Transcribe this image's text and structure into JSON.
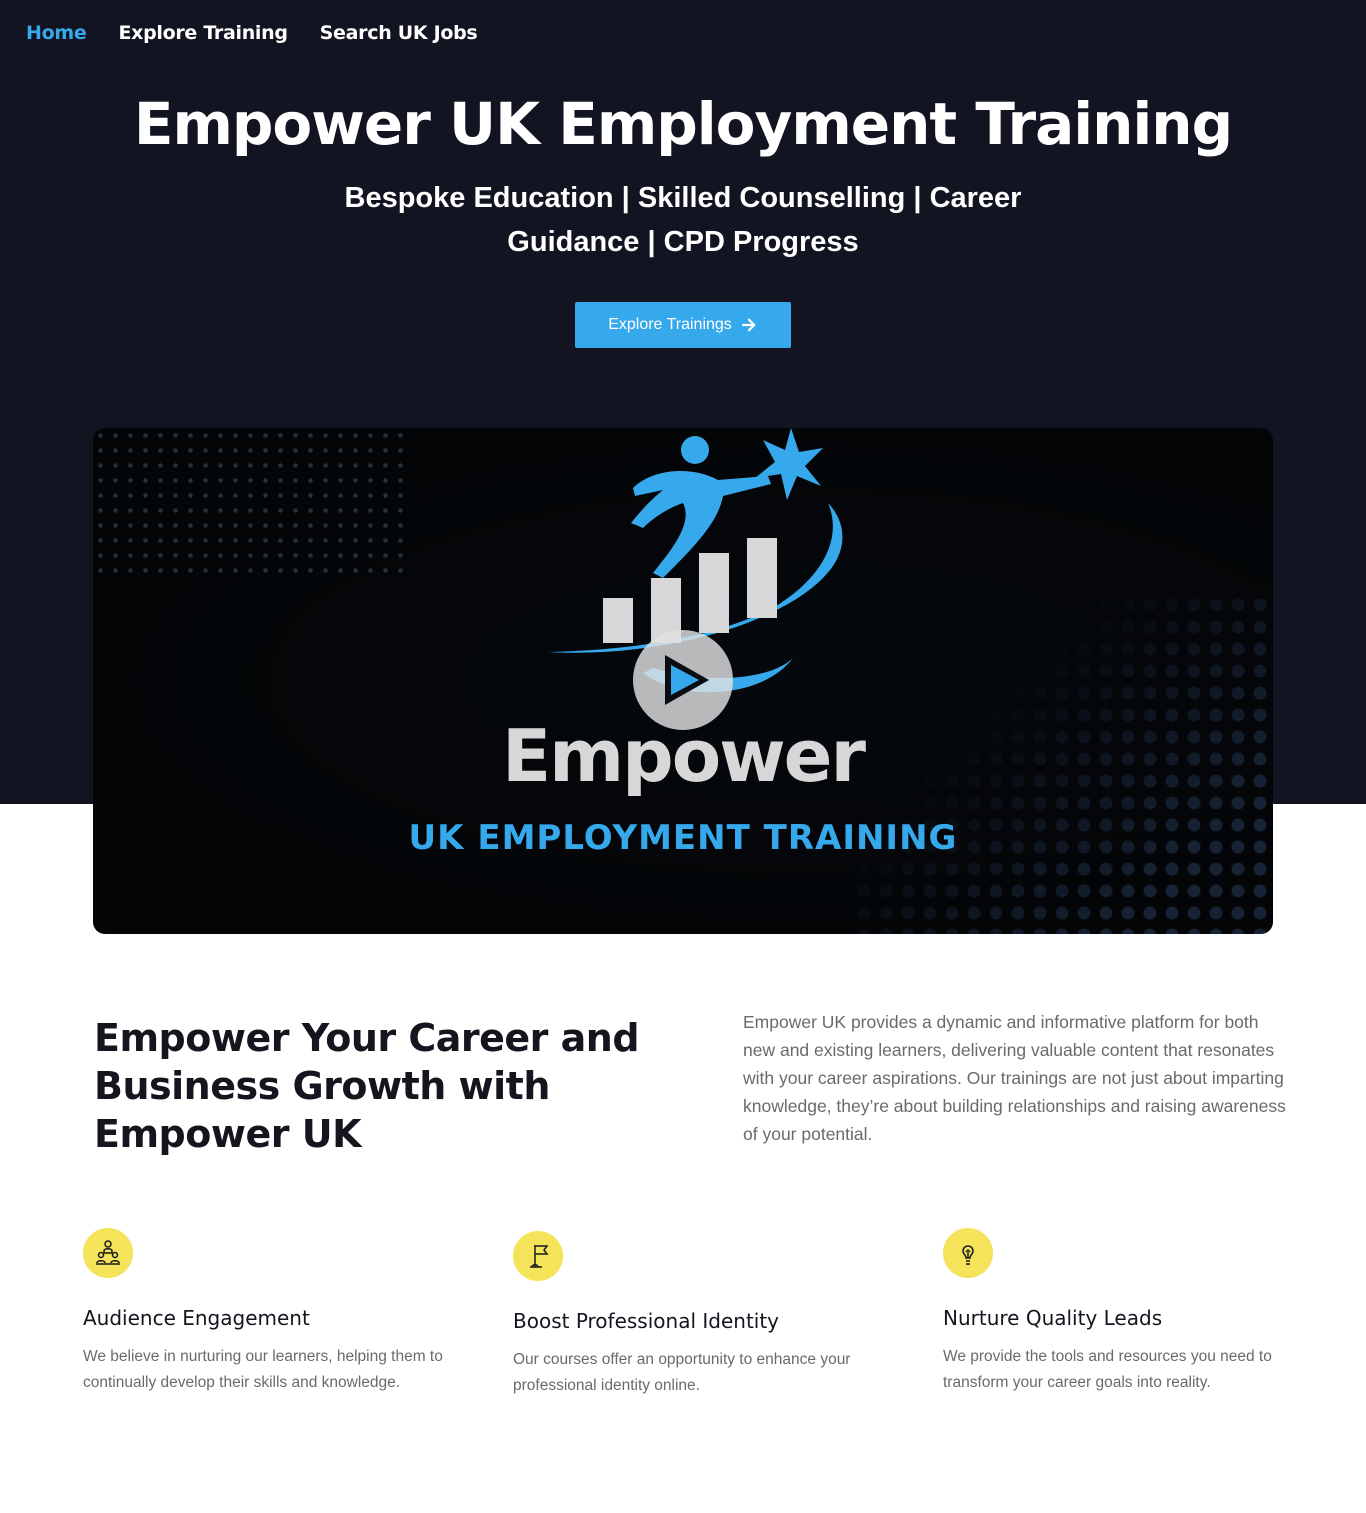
{
  "nav": {
    "items": [
      {
        "label": "Home",
        "active": true
      },
      {
        "label": "Explore Training",
        "active": false
      },
      {
        "label": "Search UK Jobs",
        "active": false
      }
    ]
  },
  "hero": {
    "title": "Empower UK Employment Training",
    "subtitle_line1": "Bespoke Education | Skilled Counselling | Career",
    "subtitle_line2": "Guidance | CPD Progress",
    "cta_label": "Explore Trainings",
    "cta_icon": "arrow-right-icon"
  },
  "video": {
    "brand_word": "Empower",
    "brand_sub": "UK EMPLOYMENT TRAINING",
    "play_icon": "play-icon"
  },
  "about": {
    "title": "Empower Your Career and Business Growth with Empower UK",
    "text": "Empower UK provides a dynamic and informative platform for both new and existing learners, delivering valuable content that resonates with your career aspirations. Our trainings are not just about imparting knowledge, they’re about building relationships and raising awareness of your potential."
  },
  "features": [
    {
      "title": "Audience Engagement",
      "text": "We believe in nurturing our learners, helping them to continually develop their skills and knowledge.",
      "icon": "team-icon"
    },
    {
      "title": "Boost Professional Identity",
      "text": "Our courses offer an opportunity to enhance your professional identity online.",
      "icon": "flag-icon"
    },
    {
      "title": "Nurture Quality Leads",
      "text": "We provide the tools and resources you need to transform your career goals into reality.",
      "icon": "lightbulb-icon"
    }
  ],
  "colors": {
    "hero_bg": "#121521",
    "accent": "#36a9ec",
    "icon_circle": "#f5e35a"
  }
}
